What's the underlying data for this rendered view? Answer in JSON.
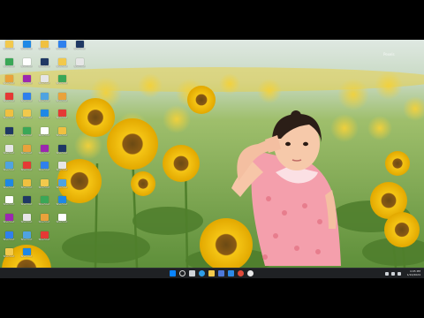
{
  "desktop": {
    "wallpaper": "little girl saluting in a sunflower field",
    "watermark": "Pexels",
    "icon_label": "Shortcut",
    "icon_colors": [
      "#f2c94c",
      "#4fa3e0",
      "#e9a23b",
      "#ffffff",
      "#f0c040",
      "#2f80ed",
      "#e6e6e6",
      "#3aa757",
      "#1e88e5",
      "#e53935",
      "#9c27b0",
      "#1f3864"
    ]
  },
  "taskbar": {
    "apps": [
      "windows-icon",
      "search-icon",
      "task-view-icon",
      "edge-icon",
      "file-explorer-icon",
      "store-icon",
      "mail-icon",
      "chrome-icon",
      "media-icon"
    ],
    "time": "4:05 PM",
    "date": "1/10/2024"
  },
  "colors": {
    "taskbar": "#1f2124",
    "accent": "#0a84ff"
  }
}
